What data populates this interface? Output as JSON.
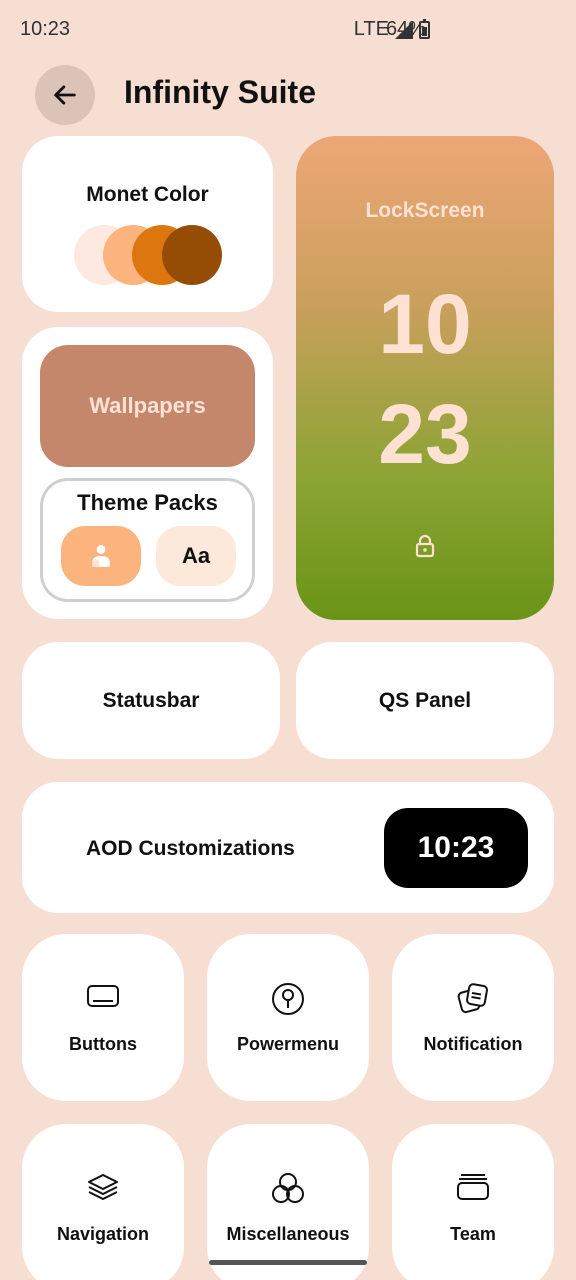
{
  "status_bar": {
    "time": "10:23",
    "network": "LTE",
    "battery": "64%"
  },
  "header": {
    "title": "Infinity Suite",
    "back_icon": "arrow-left-icon"
  },
  "monet": {
    "label": "Monet Color",
    "swatches": [
      "#fde9df",
      "#fbb47e",
      "#de7610",
      "#954d05"
    ]
  },
  "wallpapers": {
    "label": "Wallpapers"
  },
  "theme_packs": {
    "title": "Theme Packs",
    "font_label": "Aa"
  },
  "lockscreen": {
    "title": "LockScreen",
    "hour": "10",
    "minute": "23"
  },
  "statusbar": {
    "label": "Statusbar"
  },
  "qs_panel": {
    "label": "QS Panel"
  },
  "aod": {
    "label": "AOD Customizations",
    "clock": "10:23"
  },
  "tiles": [
    {
      "label": "Buttons",
      "icon": "button-icon"
    },
    {
      "label": "Powermenu",
      "icon": "power-icon"
    },
    {
      "label": "Notification",
      "icon": "notification-icon"
    },
    {
      "label": "Navigation",
      "icon": "layers-icon"
    },
    {
      "label": "Miscellaneous",
      "icon": "circles-icon"
    },
    {
      "label": "Team",
      "icon": "team-icon"
    }
  ]
}
